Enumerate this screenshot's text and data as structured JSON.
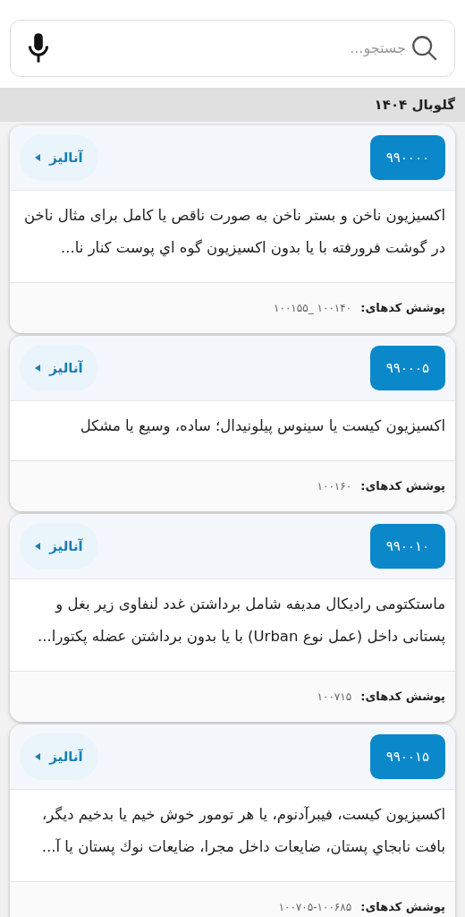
{
  "search": {
    "placeholder": "جستجو..."
  },
  "section": {
    "title": "گلوبال ۱۴۰۴"
  },
  "cards": [
    {
      "code": "۹۹۰۰۰۰",
      "analyze": "آنالیز",
      "description": "اکسیزیون  ناخن و بستر ناخن به صورت ناقص یا کامل برای مثال ناخن در گوشت فرورفته با یا بدون اکسیزیون گوه اي پوست کنار نا...",
      "coverage_label": "پوشش کدهای:",
      "coverage_codes": "۱۰۰۱۴۰ _۱۰۰۱۵۵"
    },
    {
      "code": "۹۹۰۰۰۵",
      "analyze": "آنالیز",
      "description": "اکسیزیون کیست یا سینوس پیلونیدال؛ ساده، وسیع یا مشکل",
      "coverage_label": "پوشش کدهای:",
      "coverage_codes": "۱۰۰۱۶۰"
    },
    {
      "code": "۹۹۰۰۱۰",
      "analyze": "آنالیز",
      "description": "ماستکتومی رادیکال مدیفه شامل برداشتن غدد لنفاوی زیر بغل و پستانی داخل (عمل نوع Urban) با یا بدون برداشتن عضله پکتورا...",
      "coverage_label": "پوشش کدهای:",
      "coverage_codes": "۱۰۰۷۱۵"
    },
    {
      "code": "۹۹۰۰۱۵",
      "analyze": "آنالیز",
      "description": "اکسیزیون کیست، فیبرآدنوم، یا هر تومور خوش خیم یا بدخیم دیگر، بافت نابجاي پستان، ضایعات داخل مجرا، ضایعات نوك پستان یا آ...",
      "coverage_label": "پوشش کدهای:",
      "coverage_codes": "۱۰۰۷۰۵-۱۰۰۶۸۵"
    }
  ]
}
